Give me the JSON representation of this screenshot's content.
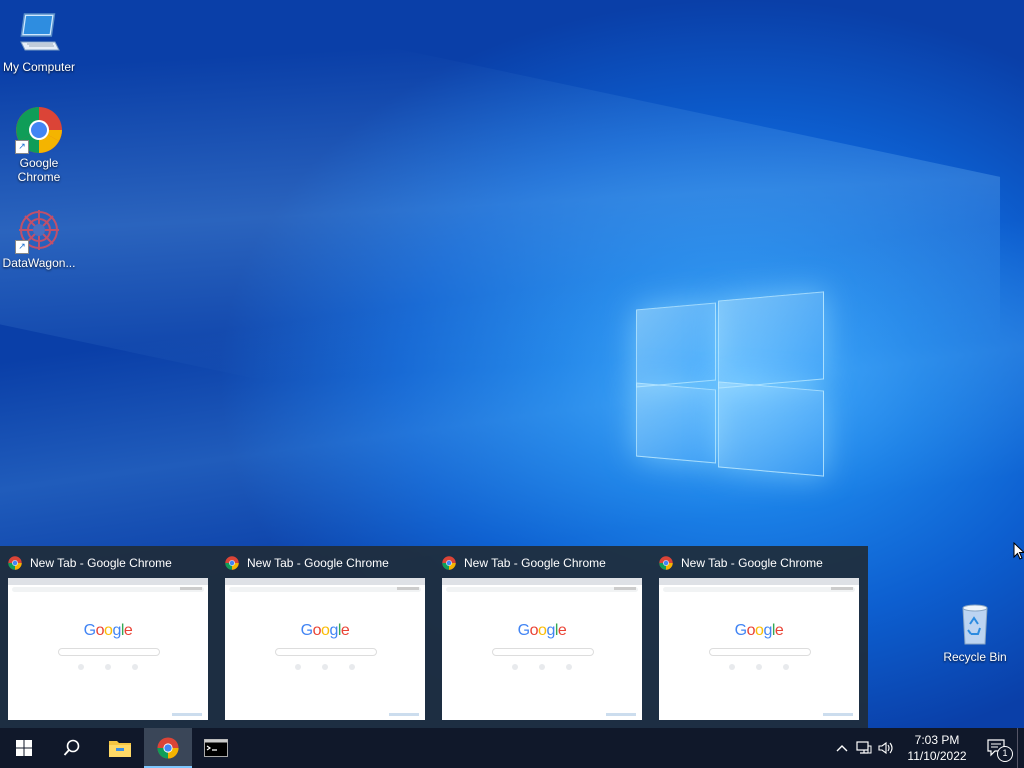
{
  "desktop": {
    "icons": [
      {
        "label": "My Computer",
        "icon": "computer-icon"
      },
      {
        "label": "Google\nChrome",
        "icon": "chrome-icon"
      },
      {
        "label": "DataWagon...",
        "icon": "datawagon-icon"
      },
      {
        "label": "Recycle Bin",
        "icon": "recycle-bin-icon"
      }
    ]
  },
  "thumbnails": [
    {
      "title": "New Tab - Google Chrome",
      "logo": "Google"
    },
    {
      "title": "New Tab - Google Chrome",
      "logo": "Google"
    },
    {
      "title": "New Tab - Google Chrome",
      "logo": "Google"
    },
    {
      "title": "New Tab - Google Chrome",
      "logo": "Google"
    }
  ],
  "taskbar": {
    "buttons": [
      "start-icon",
      "search-icon",
      "file-explorer-icon",
      "chrome-icon",
      "terminal-icon"
    ],
    "tray": {
      "time": "7:03 PM",
      "date": "11/10/2022",
      "notification_count": "1"
    }
  },
  "colors": {
    "accent": "#7dc7ff",
    "taskbar": "#10182a",
    "desktop": "#0d5fd0"
  }
}
